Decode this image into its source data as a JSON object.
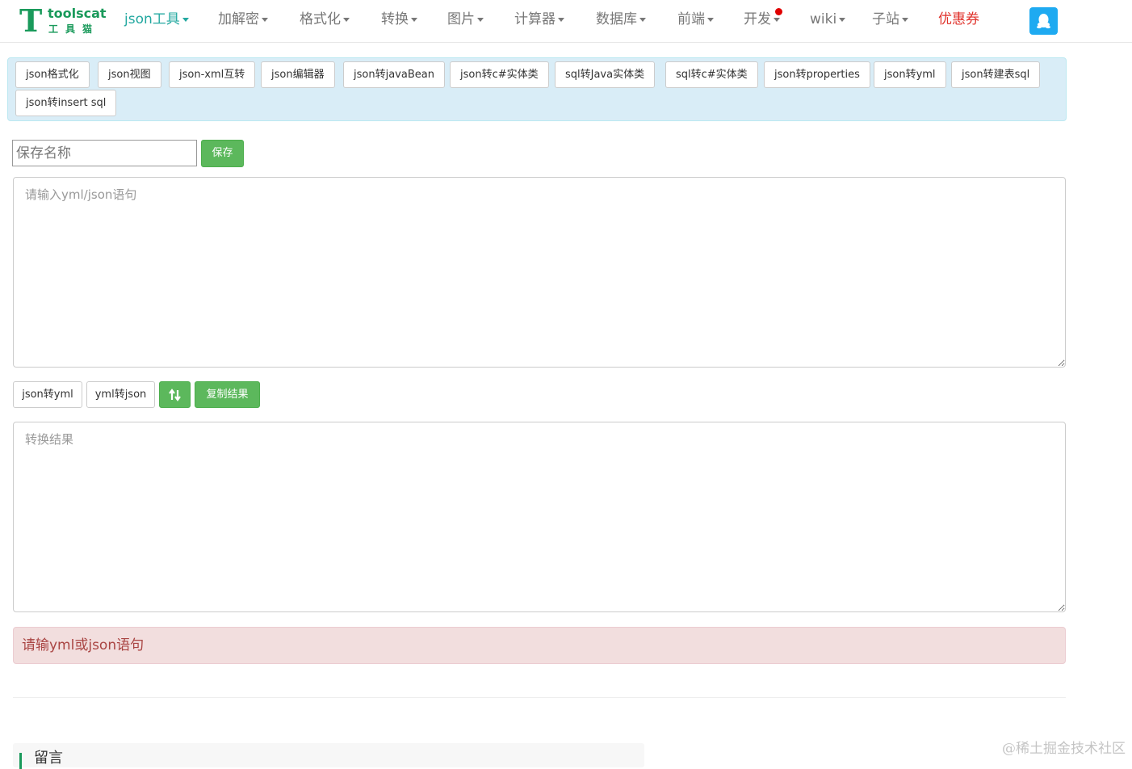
{
  "brand": {
    "name_en": "toolscat",
    "name_cn": "工具猫",
    "logo_letter": "T",
    "color": "#1a9a5b"
  },
  "nav": {
    "items": [
      {
        "label": "json工具",
        "active": true
      },
      {
        "label": "加解密"
      },
      {
        "label": "格式化"
      },
      {
        "label": "转换"
      },
      {
        "label": "图片"
      },
      {
        "label": "计算器"
      },
      {
        "label": "数据库"
      },
      {
        "label": "前端"
      },
      {
        "label": "开发"
      },
      {
        "label": "wiki"
      },
      {
        "label": "子站"
      }
    ],
    "coupon": "优惠券",
    "qq_icon": "qq-penguin-icon"
  },
  "tools": [
    "json格式化",
    "json视图",
    "json-xml互转",
    "json编辑器",
    "json转javaBean",
    "json转c#实体类",
    "sql转Java实体类",
    "sql转c#实体类",
    "json转properties",
    "json转yml",
    "json转建表sql",
    "json转insert sql"
  ],
  "save": {
    "placeholder": "保存名称",
    "button": "保存"
  },
  "input": {
    "placeholder": "请输入yml/json语句"
  },
  "actions": {
    "json_to_yml": "json转yml",
    "yml_to_json": "yml转json",
    "swap_icon": "swap-vertical-icon",
    "copy": "复制结果"
  },
  "output": {
    "placeholder": "转换结果"
  },
  "alert": {
    "text": "请输yml或json语句"
  },
  "comments": {
    "title": "留言"
  },
  "watermark": "@稀土掘金技术社区",
  "colors": {
    "success": "#5cb85c",
    "info_bg": "#d9edf7",
    "danger_bg": "#f2dede",
    "danger_text": "#a94442",
    "nav_active": "#23a8a0",
    "coupon": "#e0322b",
    "qq": "#1eaaf1"
  }
}
